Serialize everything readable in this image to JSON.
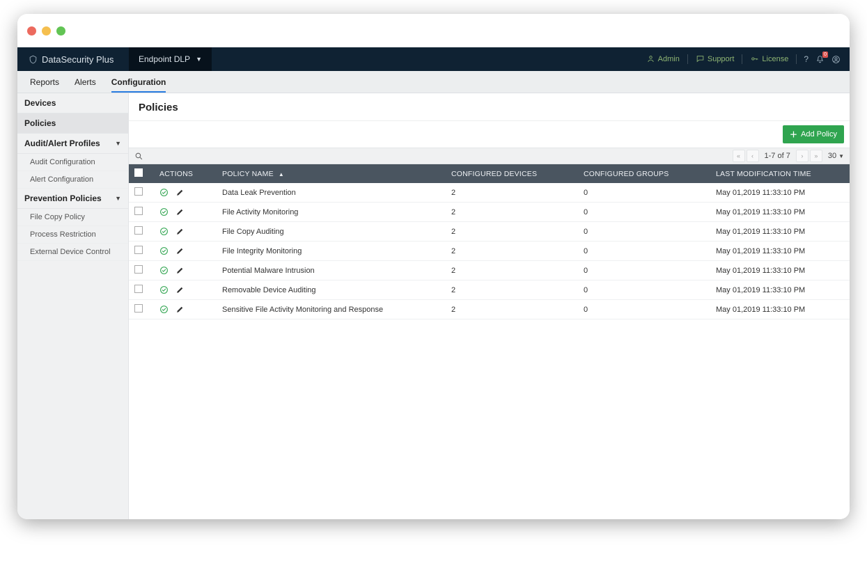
{
  "brand": "DataSecurity Plus",
  "module": "Endpoint DLP",
  "top_right": {
    "admin": "Admin",
    "support": "Support",
    "license": "License",
    "notif_badge": "0"
  },
  "tabs": {
    "reports": "Reports",
    "alerts": "Alerts",
    "configuration": "Configuration"
  },
  "sidebar": {
    "devices": "Devices",
    "policies": "Policies",
    "audit_alert": "Audit/Alert Profiles",
    "audit_conf": "Audit Configuration",
    "alert_conf": "Alert Configuration",
    "prevention": "Prevention Policies",
    "file_copy": "File Copy Policy",
    "proc_restrict": "Process Restriction",
    "ext_dev": "External Device Control"
  },
  "page": {
    "title": "Policies",
    "add_btn": "Add Policy"
  },
  "grid": {
    "pagination": "1-7 of 7",
    "page_size": "30",
    "columns": {
      "actions": "ACTIONS",
      "policy_name": "POLICY NAME",
      "conf_devices": "CONFIGURED DEVICES",
      "conf_groups": "CONFIGURED GROUPS",
      "last_mod": "LAST MODIFICATION TIME"
    },
    "rows": [
      {
        "name": "Data Leak Prevention",
        "devices": "2",
        "groups": "0",
        "mod": "May 01,2019 11:33:10 PM"
      },
      {
        "name": "File Activity Monitoring",
        "devices": "2",
        "groups": "0",
        "mod": "May 01,2019 11:33:10 PM"
      },
      {
        "name": "File Copy Auditing",
        "devices": "2",
        "groups": "0",
        "mod": "May 01,2019 11:33:10 PM"
      },
      {
        "name": "File Integrity Monitoring",
        "devices": "2",
        "groups": "0",
        "mod": "May 01,2019 11:33:10 PM"
      },
      {
        "name": "Potential Malware Intrusion",
        "devices": "2",
        "groups": "0",
        "mod": "May 01,2019 11:33:10 PM"
      },
      {
        "name": "Removable Device Auditing",
        "devices": "2",
        "groups": "0",
        "mod": "May 01,2019 11:33:10 PM"
      },
      {
        "name": "Sensitive File Activity Monitoring and Response",
        "devices": "2",
        "groups": "0",
        "mod": "May 01,2019 11:33:10 PM"
      }
    ]
  }
}
